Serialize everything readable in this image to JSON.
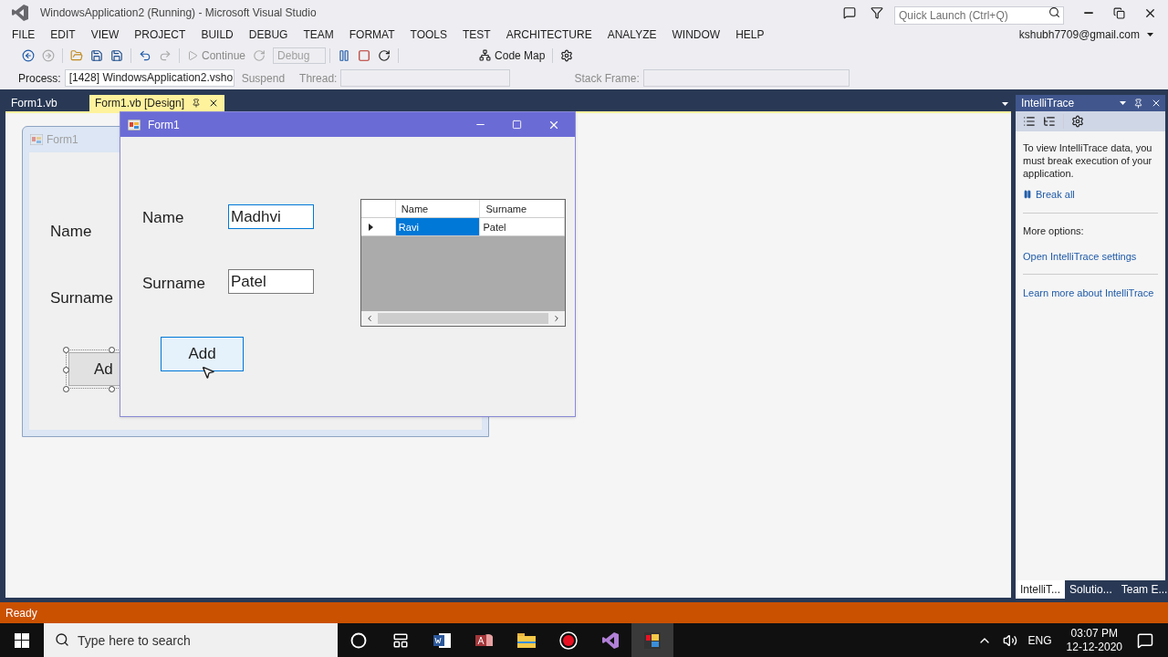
{
  "window": {
    "title": "WindowsApplication2 (Running) - Microsoft Visual Studio"
  },
  "quick_launch": {
    "placeholder": "Quick Launch (Ctrl+Q)"
  },
  "menu": [
    "FILE",
    "EDIT",
    "VIEW",
    "PROJECT",
    "BUILD",
    "DEBUG",
    "TEAM",
    "FORMAT",
    "TOOLS",
    "TEST",
    "ARCHITECTURE",
    "ANALYZE",
    "WINDOW",
    "HELP"
  ],
  "account": "kshubh7709@gmail.com",
  "toolbar": {
    "continue": "Continue",
    "configuration": "Debug",
    "code_map": "Code Map"
  },
  "debug_location": {
    "process_label": "Process:",
    "process": "[1428] WindowsApplication2.vsho",
    "suspend": "Suspend",
    "thread_label": "Thread:",
    "stack_frame_label": "Stack Frame:"
  },
  "document_tabs": [
    {
      "label": "Form1.vb",
      "selected": false
    },
    {
      "label": "Form1.vb [Design]",
      "selected": true
    }
  ],
  "designer_form": {
    "title": "Form1",
    "labels": [
      "Name",
      "Surname"
    ],
    "button": "Ad"
  },
  "running_form": {
    "title": "Form1",
    "fields": [
      {
        "label": "Name",
        "value": "Madhvi",
        "focused": true
      },
      {
        "label": "Surname",
        "value": "Patel",
        "focused": false
      }
    ],
    "button": "Add",
    "grid": {
      "columns": [
        "Name",
        "Surname"
      ],
      "rows": [
        {
          "cells": [
            "Ravi",
            "Patel"
          ],
          "selected": true
        }
      ]
    }
  },
  "intellitrace": {
    "title": "IntelliTrace",
    "message": "To view IntelliTrace data, you must break execution of your application.",
    "break_all": "Break all",
    "more_options": "More options:",
    "links": [
      "Open IntelliTrace settings",
      "Learn more about IntelliTrace"
    ]
  },
  "panel_tabs": [
    {
      "label": "IntelliT...",
      "selected": true
    },
    {
      "label": "Solutio...",
      "selected": false
    },
    {
      "label": "Team E...",
      "selected": false
    }
  ],
  "status_bar": {
    "text": "Ready"
  },
  "taskbar": {
    "search_placeholder": "Type here to search",
    "apps": [
      {
        "kind": "cortana",
        "active": false
      },
      {
        "kind": "taskview",
        "active": false
      },
      {
        "kind": "word",
        "active": false
      },
      {
        "kind": "access",
        "active": false
      },
      {
        "kind": "explorer",
        "active": false
      },
      {
        "kind": "record",
        "active": false
      },
      {
        "kind": "visualstudio",
        "active": false
      },
      {
        "kind": "formapp",
        "active": true
      }
    ],
    "language": "ENG",
    "time": "03:07 PM",
    "date": "12-12-2020"
  }
}
